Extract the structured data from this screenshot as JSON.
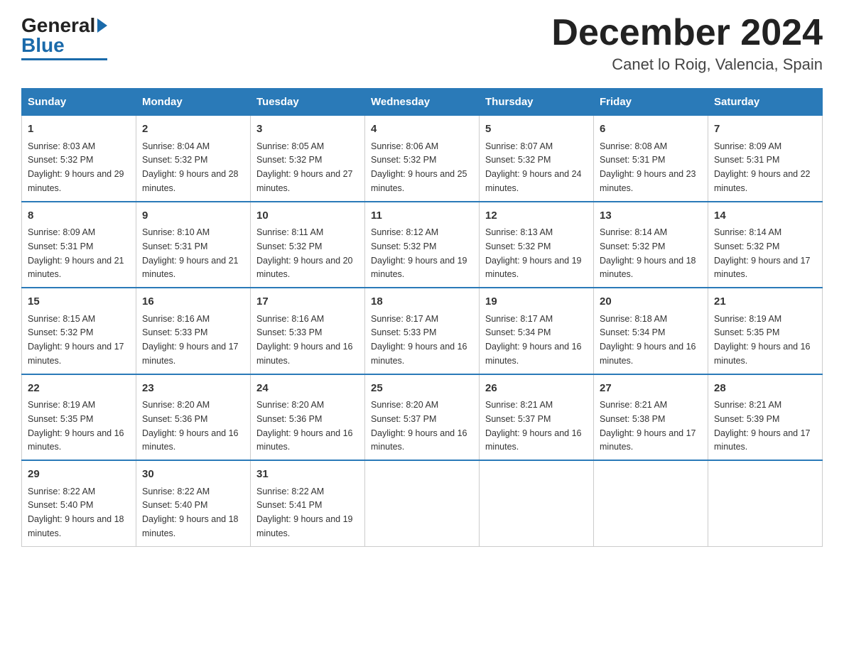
{
  "header": {
    "logo_general": "General",
    "logo_blue": "Blue",
    "month_title": "December 2024",
    "subtitle": "Canet lo Roig, Valencia, Spain"
  },
  "days_of_week": [
    "Sunday",
    "Monday",
    "Tuesday",
    "Wednesday",
    "Thursday",
    "Friday",
    "Saturday"
  ],
  "weeks": [
    [
      {
        "day": "1",
        "sunrise": "8:03 AM",
        "sunset": "5:32 PM",
        "daylight": "9 hours and 29 minutes."
      },
      {
        "day": "2",
        "sunrise": "8:04 AM",
        "sunset": "5:32 PM",
        "daylight": "9 hours and 28 minutes."
      },
      {
        "day": "3",
        "sunrise": "8:05 AM",
        "sunset": "5:32 PM",
        "daylight": "9 hours and 27 minutes."
      },
      {
        "day": "4",
        "sunrise": "8:06 AM",
        "sunset": "5:32 PM",
        "daylight": "9 hours and 25 minutes."
      },
      {
        "day": "5",
        "sunrise": "8:07 AM",
        "sunset": "5:32 PM",
        "daylight": "9 hours and 24 minutes."
      },
      {
        "day": "6",
        "sunrise": "8:08 AM",
        "sunset": "5:31 PM",
        "daylight": "9 hours and 23 minutes."
      },
      {
        "day": "7",
        "sunrise": "8:09 AM",
        "sunset": "5:31 PM",
        "daylight": "9 hours and 22 minutes."
      }
    ],
    [
      {
        "day": "8",
        "sunrise": "8:09 AM",
        "sunset": "5:31 PM",
        "daylight": "9 hours and 21 minutes."
      },
      {
        "day": "9",
        "sunrise": "8:10 AM",
        "sunset": "5:31 PM",
        "daylight": "9 hours and 21 minutes."
      },
      {
        "day": "10",
        "sunrise": "8:11 AM",
        "sunset": "5:32 PM",
        "daylight": "9 hours and 20 minutes."
      },
      {
        "day": "11",
        "sunrise": "8:12 AM",
        "sunset": "5:32 PM",
        "daylight": "9 hours and 19 minutes."
      },
      {
        "day": "12",
        "sunrise": "8:13 AM",
        "sunset": "5:32 PM",
        "daylight": "9 hours and 19 minutes."
      },
      {
        "day": "13",
        "sunrise": "8:14 AM",
        "sunset": "5:32 PM",
        "daylight": "9 hours and 18 minutes."
      },
      {
        "day": "14",
        "sunrise": "8:14 AM",
        "sunset": "5:32 PM",
        "daylight": "9 hours and 17 minutes."
      }
    ],
    [
      {
        "day": "15",
        "sunrise": "8:15 AM",
        "sunset": "5:32 PM",
        "daylight": "9 hours and 17 minutes."
      },
      {
        "day": "16",
        "sunrise": "8:16 AM",
        "sunset": "5:33 PM",
        "daylight": "9 hours and 17 minutes."
      },
      {
        "day": "17",
        "sunrise": "8:16 AM",
        "sunset": "5:33 PM",
        "daylight": "9 hours and 16 minutes."
      },
      {
        "day": "18",
        "sunrise": "8:17 AM",
        "sunset": "5:33 PM",
        "daylight": "9 hours and 16 minutes."
      },
      {
        "day": "19",
        "sunrise": "8:17 AM",
        "sunset": "5:34 PM",
        "daylight": "9 hours and 16 minutes."
      },
      {
        "day": "20",
        "sunrise": "8:18 AM",
        "sunset": "5:34 PM",
        "daylight": "9 hours and 16 minutes."
      },
      {
        "day": "21",
        "sunrise": "8:19 AM",
        "sunset": "5:35 PM",
        "daylight": "9 hours and 16 minutes."
      }
    ],
    [
      {
        "day": "22",
        "sunrise": "8:19 AM",
        "sunset": "5:35 PM",
        "daylight": "9 hours and 16 minutes."
      },
      {
        "day": "23",
        "sunrise": "8:20 AM",
        "sunset": "5:36 PM",
        "daylight": "9 hours and 16 minutes."
      },
      {
        "day": "24",
        "sunrise": "8:20 AM",
        "sunset": "5:36 PM",
        "daylight": "9 hours and 16 minutes."
      },
      {
        "day": "25",
        "sunrise": "8:20 AM",
        "sunset": "5:37 PM",
        "daylight": "9 hours and 16 minutes."
      },
      {
        "day": "26",
        "sunrise": "8:21 AM",
        "sunset": "5:37 PM",
        "daylight": "9 hours and 16 minutes."
      },
      {
        "day": "27",
        "sunrise": "8:21 AM",
        "sunset": "5:38 PM",
        "daylight": "9 hours and 17 minutes."
      },
      {
        "day": "28",
        "sunrise": "8:21 AM",
        "sunset": "5:39 PM",
        "daylight": "9 hours and 17 minutes."
      }
    ],
    [
      {
        "day": "29",
        "sunrise": "8:22 AM",
        "sunset": "5:40 PM",
        "daylight": "9 hours and 18 minutes."
      },
      {
        "day": "30",
        "sunrise": "8:22 AM",
        "sunset": "5:40 PM",
        "daylight": "9 hours and 18 minutes."
      },
      {
        "day": "31",
        "sunrise": "8:22 AM",
        "sunset": "5:41 PM",
        "daylight": "9 hours and 19 minutes."
      },
      null,
      null,
      null,
      null
    ]
  ],
  "labels": {
    "sunrise_prefix": "Sunrise: ",
    "sunset_prefix": "Sunset: ",
    "daylight_prefix": "Daylight: "
  }
}
